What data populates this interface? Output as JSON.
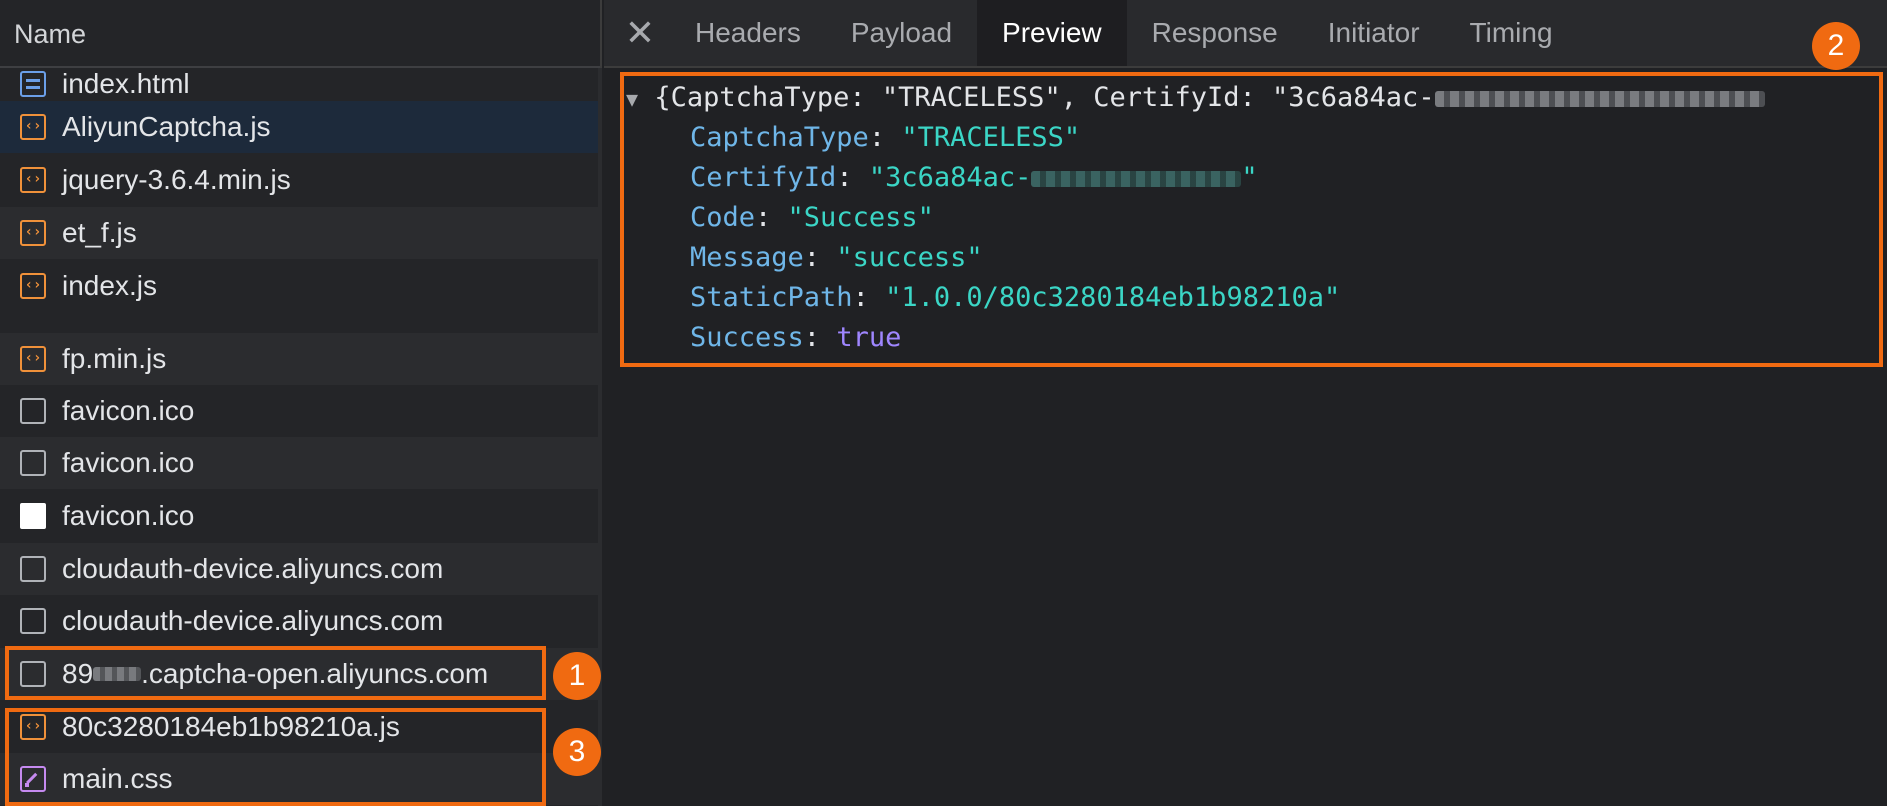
{
  "left_panel": {
    "header": "Name",
    "rows": [
      {
        "label": "index.html",
        "icon": "document-icon"
      },
      {
        "label": "AliyunCaptcha.js",
        "icon": "script-icon"
      },
      {
        "label": "jquery-3.6.4.min.js",
        "icon": "script-icon"
      },
      {
        "label": "et_f.js",
        "icon": "script-icon"
      },
      {
        "label": "index.js",
        "icon": "script-icon"
      },
      {
        "label": "fp.min.js",
        "icon": "script-icon"
      },
      {
        "label": "favicon.ico",
        "icon": "blank-file-icon"
      },
      {
        "label": "favicon.ico",
        "icon": "blank-file-icon"
      },
      {
        "label": "favicon.ico",
        "icon": "image-icon"
      },
      {
        "label": "cloudauth-device.aliyuncs.com",
        "icon": "blank-file-icon"
      },
      {
        "label": "cloudauth-device.aliyuncs.com",
        "icon": "blank-file-icon"
      },
      {
        "label_prefix": "89",
        "label": ".captcha-open.aliyuncs.com",
        "icon": "blank-file-icon"
      },
      {
        "label": "80c3280184eb1b98210a.js",
        "icon": "script-icon"
      },
      {
        "label": "main.css",
        "icon": "stylesheet-icon"
      }
    ]
  },
  "tabs": {
    "close": "✕",
    "items": [
      "Headers",
      "Payload",
      "Preview",
      "Response",
      "Initiator",
      "Timing"
    ],
    "active": "Preview"
  },
  "preview": {
    "summary_prefix": "{CaptchaType: \"TRACELESS\", CertifyId: \"3c6a84ac-",
    "fields": [
      {
        "key": "CaptchaType",
        "value": "\"TRACELESS\"",
        "type": "string"
      },
      {
        "key": "CertifyId",
        "value": "\"3c6a84ac-",
        "value_suffix": "\"",
        "type": "string"
      },
      {
        "key": "Code",
        "value": "\"Success\"",
        "type": "string"
      },
      {
        "key": "Message",
        "value": "\"success\"",
        "type": "string"
      },
      {
        "key": "StaticPath",
        "value": "\"1.0.0/80c3280184eb1b98210a\"",
        "type": "string"
      },
      {
        "key": "Success",
        "value": "true",
        "type": "boolean"
      }
    ]
  },
  "annotations": [
    "1",
    "2",
    "3"
  ],
  "colors": {
    "accent": "#f06a11",
    "key": "#6fb6e8",
    "string": "#3bd6c6",
    "boolean": "#9f86ff",
    "selected_row": "#1d2a3b"
  }
}
